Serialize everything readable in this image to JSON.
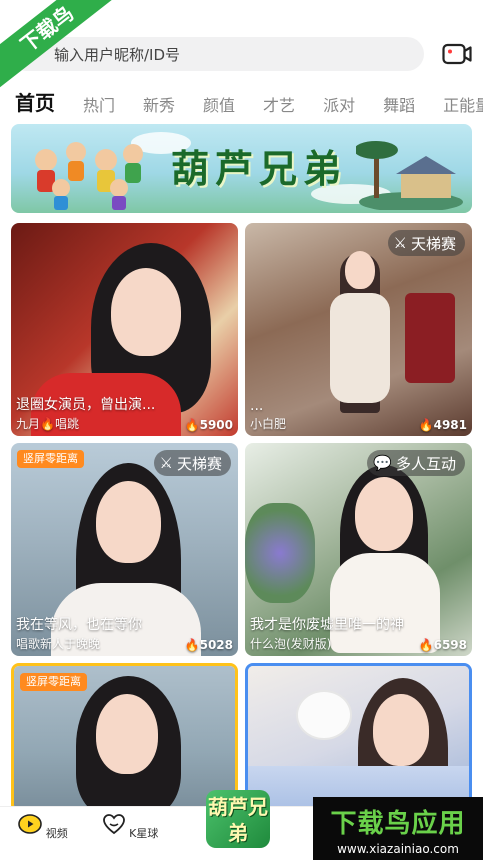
{
  "watermark": {
    "corner_text": "下载鸟",
    "bottom_title": "下载鸟应用",
    "bottom_url": "www.xiazainiao.com"
  },
  "search": {
    "placeholder": "输入用户昵称/ID号",
    "shown_text": "输入用户昵称/ID号"
  },
  "tabs": [
    "首页",
    "热门",
    "新秀",
    "颜值",
    "才艺",
    "派对",
    "舞蹈",
    "正能量"
  ],
  "active_tab": 0,
  "banner": {
    "title": "葫芦兄弟"
  },
  "cards": [
    {
      "title": "退圈女演员，曾出演...",
      "sub": "九月🔥唱跳",
      "heat": "5900",
      "badge": "",
      "tag": ""
    },
    {
      "title": "...",
      "sub": "小白肥",
      "heat": "4981",
      "badge": "天梯赛",
      "tag": ""
    },
    {
      "title": "我在等风，也在等你",
      "sub": "唱歌新人于晚晚",
      "heat": "5028",
      "badge": "天梯赛",
      "tag": "竖屏零距离"
    },
    {
      "title": "我才是你废墟里唯一的神",
      "sub": "什么泡(发财版)",
      "heat": "6598",
      "badge": "多人互动",
      "tag": ""
    },
    {
      "title": "",
      "sub": "",
      "heat": "",
      "badge": "",
      "tag": "竖屏零距离"
    },
    {
      "title": "",
      "sub": "",
      "heat": "",
      "badge": "",
      "tag": ""
    }
  ],
  "bottom_nav": [
    {
      "label": "视频",
      "icon": "video-icon"
    },
    {
      "label": "K星球",
      "icon": "heart-planet-icon"
    }
  ],
  "center_logo": {
    "text": "葫芦兄弟"
  },
  "colors": {
    "accent": "#ffcc00",
    "tag_orange": "#ff8a1f",
    "watermark_green": "#2fae4a"
  }
}
